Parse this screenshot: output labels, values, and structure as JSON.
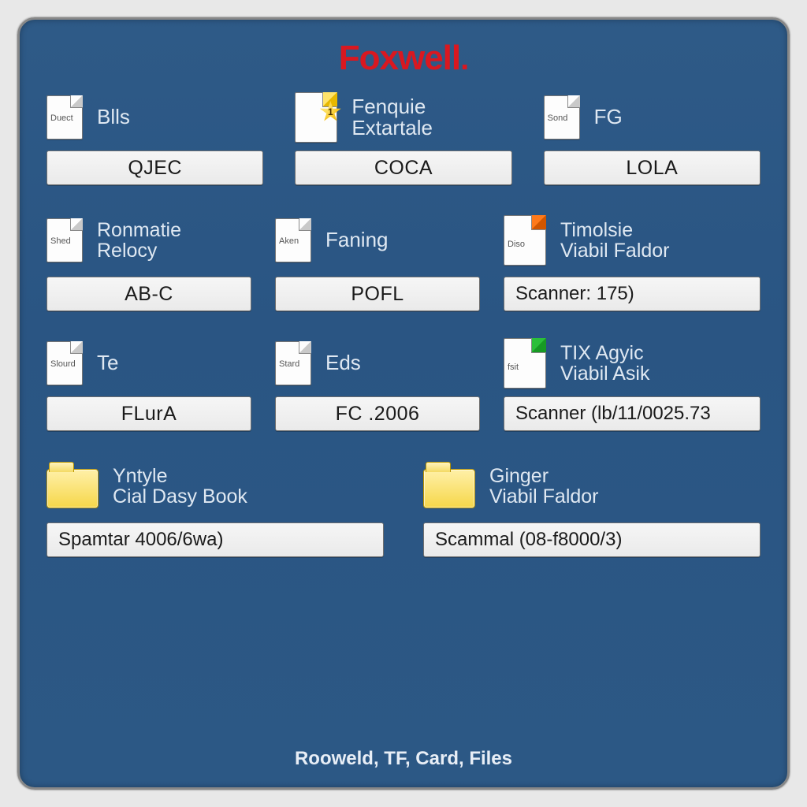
{
  "brand": "Foxwell",
  "footer": "Rooweld, TF, Card, Files",
  "rows": {
    "r1": [
      {
        "tag": "Duect",
        "caption": "Blls",
        "field": "QJEC"
      },
      {
        "tag": "",
        "caption": "Fenquie\nExtartale",
        "field": "COCA",
        "badge": "star"
      },
      {
        "tag": "Sond",
        "caption": "FG",
        "field": "LOLA"
      }
    ],
    "r2": [
      {
        "tag": "Shed",
        "caption": "Ronmatie\nRelocy",
        "field": "AB-C"
      },
      {
        "tag": "Aken",
        "caption": "Faning",
        "field": "POFL"
      },
      {
        "tag": "Diso",
        "caption": "Timolsie\nViabil Faldor",
        "field": "Scanner: 175)",
        "corner": "orange"
      }
    ],
    "r3": [
      {
        "tag": "Slourd",
        "caption": "Te",
        "field": "FLurA"
      },
      {
        "tag": "Stard",
        "caption": "Eds",
        "field": "FC .2006"
      },
      {
        "tag": "fsit",
        "caption": "TIX Agyic\nViabil Asik",
        "field": "Scanner (lb/11/0025.73",
        "corner": "green"
      }
    ],
    "r4": [
      {
        "caption": "Yntyle\nCial Dasy Book",
        "field": "Spamtar 4006/6wa)"
      },
      {
        "caption": "Ginger\nViabil Faldor",
        "field": "Scammal (08-f8000/3)"
      }
    ]
  }
}
